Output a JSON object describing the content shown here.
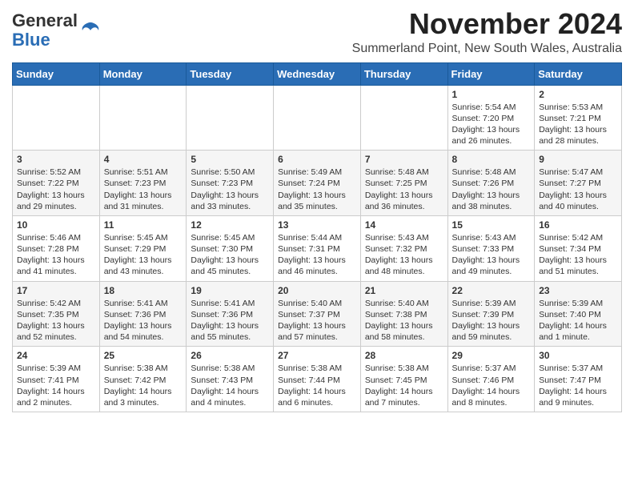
{
  "header": {
    "logo_general": "General",
    "logo_blue": "Blue",
    "month_title": "November 2024",
    "location": "Summerland Point, New South Wales, Australia"
  },
  "days_of_week": [
    "Sunday",
    "Monday",
    "Tuesday",
    "Wednesday",
    "Thursday",
    "Friday",
    "Saturday"
  ],
  "weeks": [
    [
      {
        "day": "",
        "info": ""
      },
      {
        "day": "",
        "info": ""
      },
      {
        "day": "",
        "info": ""
      },
      {
        "day": "",
        "info": ""
      },
      {
        "day": "",
        "info": ""
      },
      {
        "day": "1",
        "info": "Sunrise: 5:54 AM\nSunset: 7:20 PM\nDaylight: 13 hours and 26 minutes."
      },
      {
        "day": "2",
        "info": "Sunrise: 5:53 AM\nSunset: 7:21 PM\nDaylight: 13 hours and 28 minutes."
      }
    ],
    [
      {
        "day": "3",
        "info": "Sunrise: 5:52 AM\nSunset: 7:22 PM\nDaylight: 13 hours and 29 minutes."
      },
      {
        "day": "4",
        "info": "Sunrise: 5:51 AM\nSunset: 7:23 PM\nDaylight: 13 hours and 31 minutes."
      },
      {
        "day": "5",
        "info": "Sunrise: 5:50 AM\nSunset: 7:23 PM\nDaylight: 13 hours and 33 minutes."
      },
      {
        "day": "6",
        "info": "Sunrise: 5:49 AM\nSunset: 7:24 PM\nDaylight: 13 hours and 35 minutes."
      },
      {
        "day": "7",
        "info": "Sunrise: 5:48 AM\nSunset: 7:25 PM\nDaylight: 13 hours and 36 minutes."
      },
      {
        "day": "8",
        "info": "Sunrise: 5:48 AM\nSunset: 7:26 PM\nDaylight: 13 hours and 38 minutes."
      },
      {
        "day": "9",
        "info": "Sunrise: 5:47 AM\nSunset: 7:27 PM\nDaylight: 13 hours and 40 minutes."
      }
    ],
    [
      {
        "day": "10",
        "info": "Sunrise: 5:46 AM\nSunset: 7:28 PM\nDaylight: 13 hours and 41 minutes."
      },
      {
        "day": "11",
        "info": "Sunrise: 5:45 AM\nSunset: 7:29 PM\nDaylight: 13 hours and 43 minutes."
      },
      {
        "day": "12",
        "info": "Sunrise: 5:45 AM\nSunset: 7:30 PM\nDaylight: 13 hours and 45 minutes."
      },
      {
        "day": "13",
        "info": "Sunrise: 5:44 AM\nSunset: 7:31 PM\nDaylight: 13 hours and 46 minutes."
      },
      {
        "day": "14",
        "info": "Sunrise: 5:43 AM\nSunset: 7:32 PM\nDaylight: 13 hours and 48 minutes."
      },
      {
        "day": "15",
        "info": "Sunrise: 5:43 AM\nSunset: 7:33 PM\nDaylight: 13 hours and 49 minutes."
      },
      {
        "day": "16",
        "info": "Sunrise: 5:42 AM\nSunset: 7:34 PM\nDaylight: 13 hours and 51 minutes."
      }
    ],
    [
      {
        "day": "17",
        "info": "Sunrise: 5:42 AM\nSunset: 7:35 PM\nDaylight: 13 hours and 52 minutes."
      },
      {
        "day": "18",
        "info": "Sunrise: 5:41 AM\nSunset: 7:36 PM\nDaylight: 13 hours and 54 minutes."
      },
      {
        "day": "19",
        "info": "Sunrise: 5:41 AM\nSunset: 7:36 PM\nDaylight: 13 hours and 55 minutes."
      },
      {
        "day": "20",
        "info": "Sunrise: 5:40 AM\nSunset: 7:37 PM\nDaylight: 13 hours and 57 minutes."
      },
      {
        "day": "21",
        "info": "Sunrise: 5:40 AM\nSunset: 7:38 PM\nDaylight: 13 hours and 58 minutes."
      },
      {
        "day": "22",
        "info": "Sunrise: 5:39 AM\nSunset: 7:39 PM\nDaylight: 13 hours and 59 minutes."
      },
      {
        "day": "23",
        "info": "Sunrise: 5:39 AM\nSunset: 7:40 PM\nDaylight: 14 hours and 1 minute."
      }
    ],
    [
      {
        "day": "24",
        "info": "Sunrise: 5:39 AM\nSunset: 7:41 PM\nDaylight: 14 hours and 2 minutes."
      },
      {
        "day": "25",
        "info": "Sunrise: 5:38 AM\nSunset: 7:42 PM\nDaylight: 14 hours and 3 minutes."
      },
      {
        "day": "26",
        "info": "Sunrise: 5:38 AM\nSunset: 7:43 PM\nDaylight: 14 hours and 4 minutes."
      },
      {
        "day": "27",
        "info": "Sunrise: 5:38 AM\nSunset: 7:44 PM\nDaylight: 14 hours and 6 minutes."
      },
      {
        "day": "28",
        "info": "Sunrise: 5:38 AM\nSunset: 7:45 PM\nDaylight: 14 hours and 7 minutes."
      },
      {
        "day": "29",
        "info": "Sunrise: 5:37 AM\nSunset: 7:46 PM\nDaylight: 14 hours and 8 minutes."
      },
      {
        "day": "30",
        "info": "Sunrise: 5:37 AM\nSunset: 7:47 PM\nDaylight: 14 hours and 9 minutes."
      }
    ]
  ]
}
